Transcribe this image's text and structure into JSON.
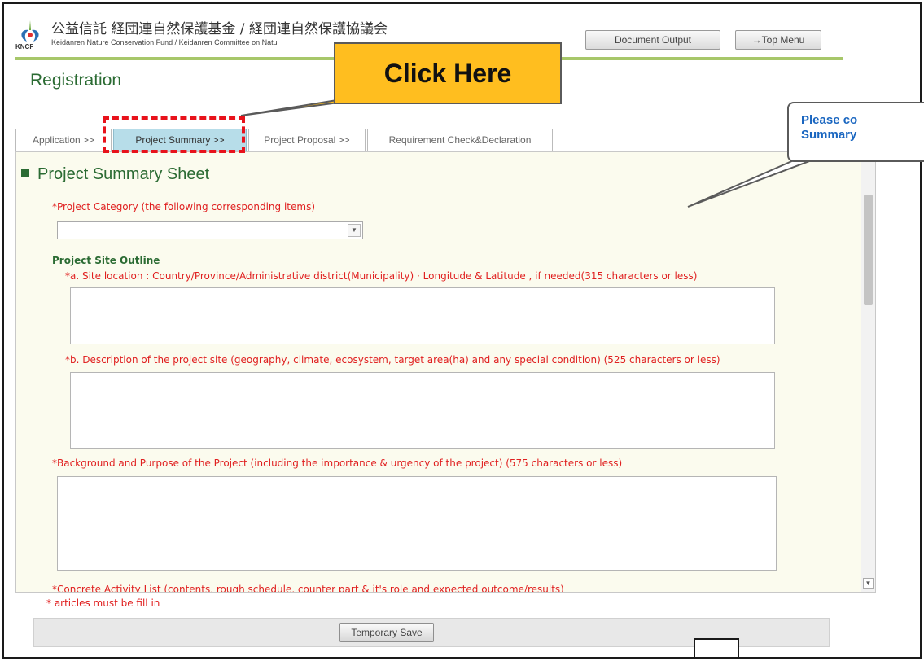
{
  "header": {
    "org_jp": "公益信託 経団連自然保護基金 / 経団連自然保護協議会",
    "org_en": "Keidanren Nature Conservation Fund / Keidanren Committee on Natu",
    "logo_text": "KNCF",
    "document_output_label": "Document Output",
    "top_menu_label": "→Top Menu"
  },
  "page_title": "Registration",
  "tabs": [
    {
      "label": "Application >>",
      "active": false
    },
    {
      "label": "Project Summary >>",
      "active": true
    },
    {
      "label": "Project Proposal >>",
      "active": false
    },
    {
      "label": "Requirement Check&Declaration",
      "active": false
    }
  ],
  "form": {
    "sheet_title": "Project Summary Sheet",
    "project_category_label": "*Project Category (the following corresponding items)",
    "project_category_value": "",
    "site_outline_label": "Project Site Outline",
    "site_location_label": "*a. Site location : Country/Province/Administrative district(Municipality) · Longitude & Latitude , if needed(315 characters or less)",
    "site_description_label": "*b. Description of the project site (geography, climate, ecosystem, target area(ha) and any special condition) (525 characters or less)",
    "background_label": "*Background and Purpose of the Project (including the importance & urgency of the project) (575 characters or less)",
    "activity_list_label": "*Concrete Activity List  (contents, rough schedule, counter part & it's role and expected outcome/results)"
  },
  "footer": {
    "required_note": "* articles must be fill in",
    "temporary_save_label": "Temporary Save"
  },
  "annotations": {
    "click_here": "Click Here",
    "callout_line1": "Please co",
    "callout_line2": "Summary"
  },
  "colors": {
    "accent_green": "#2b6b33",
    "required_red": "#e02020",
    "active_tab": "#b7dde9",
    "callout_orange": "#ffbe1f",
    "callout_blue": "#1a66c0"
  }
}
